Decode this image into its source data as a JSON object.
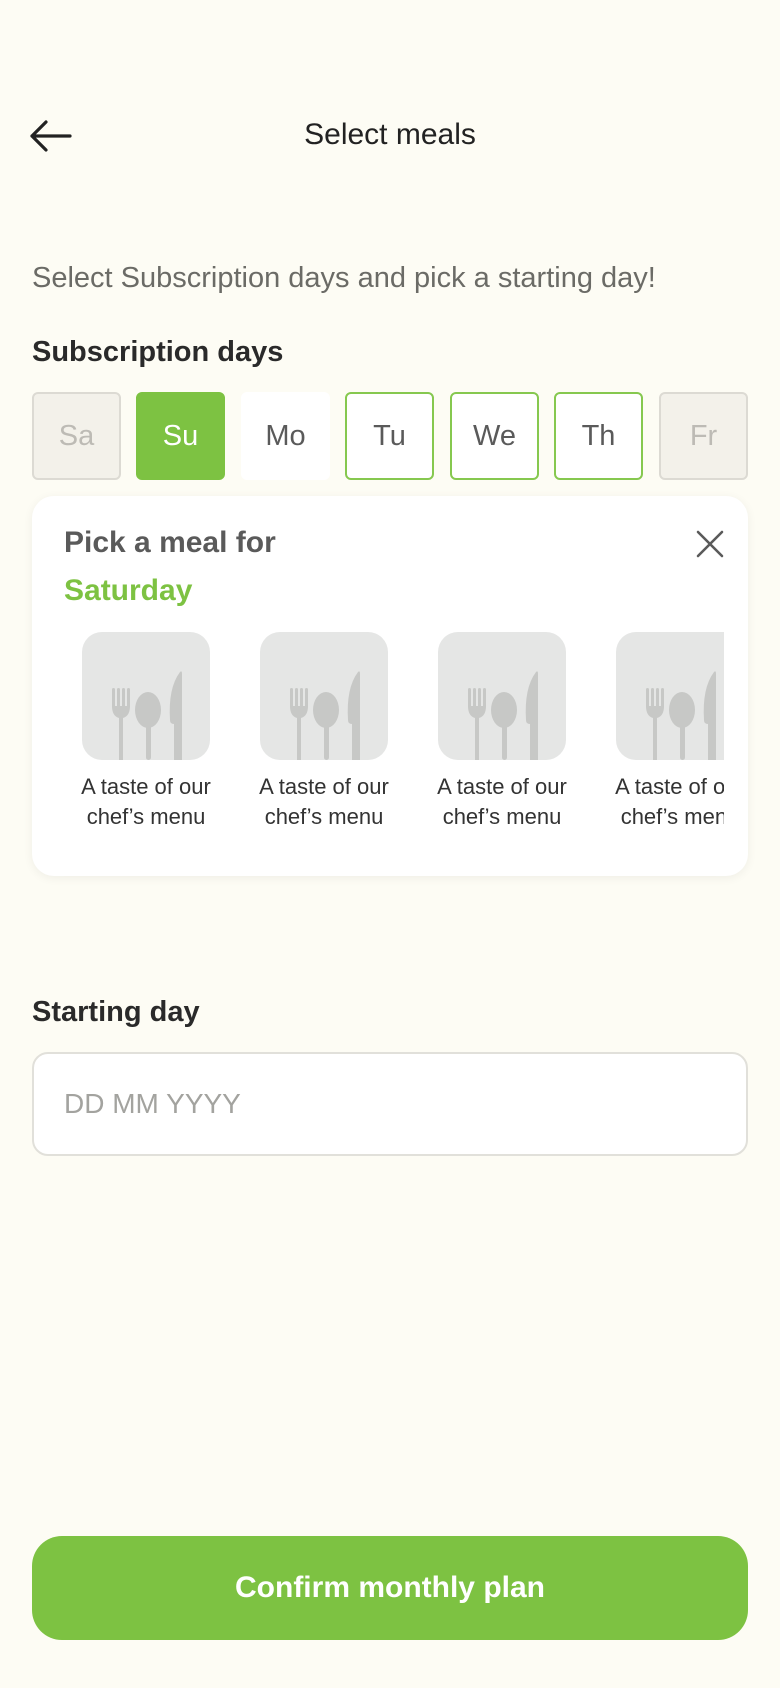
{
  "header": {
    "title": "Select meals"
  },
  "intro": "Select Subscription days and pick a starting day!",
  "subscription": {
    "label": "Subscription days",
    "days": [
      {
        "label": "Sa",
        "state": "disabled"
      },
      {
        "label": "Su",
        "state": "selected"
      },
      {
        "label": "Mo",
        "state": "plain"
      },
      {
        "label": "Tu",
        "state": "outline"
      },
      {
        "label": "We",
        "state": "outline"
      },
      {
        "label": "Th",
        "state": "outline"
      },
      {
        "label": "Fr",
        "state": "disabled"
      }
    ]
  },
  "meal_picker": {
    "title": "Pick a meal for",
    "day": "Saturday",
    "meals": [
      {
        "line1": "A taste of our",
        "line2": "chef’s menu",
        "icon": "cutlery-icon"
      },
      {
        "line1": "A taste of our",
        "line2": "chef’s menu",
        "icon": "cutlery-icon"
      },
      {
        "line1": "A taste of our",
        "line2": "chef’s menu",
        "icon": "cutlery-icon"
      },
      {
        "line1": "A taste of our",
        "line2": "chef’s menu",
        "icon": "cutlery-icon"
      }
    ]
  },
  "starting_day": {
    "label": "Starting day",
    "placeholder": "DD MM YYYY",
    "value": ""
  },
  "confirm": {
    "label": "Confirm monthly plan"
  },
  "colors": {
    "accent": "#7dc242",
    "background": "#fdfcf4",
    "disabled_bg": "#f3f1ea",
    "placeholder_thumb": "#e5e6e5"
  }
}
